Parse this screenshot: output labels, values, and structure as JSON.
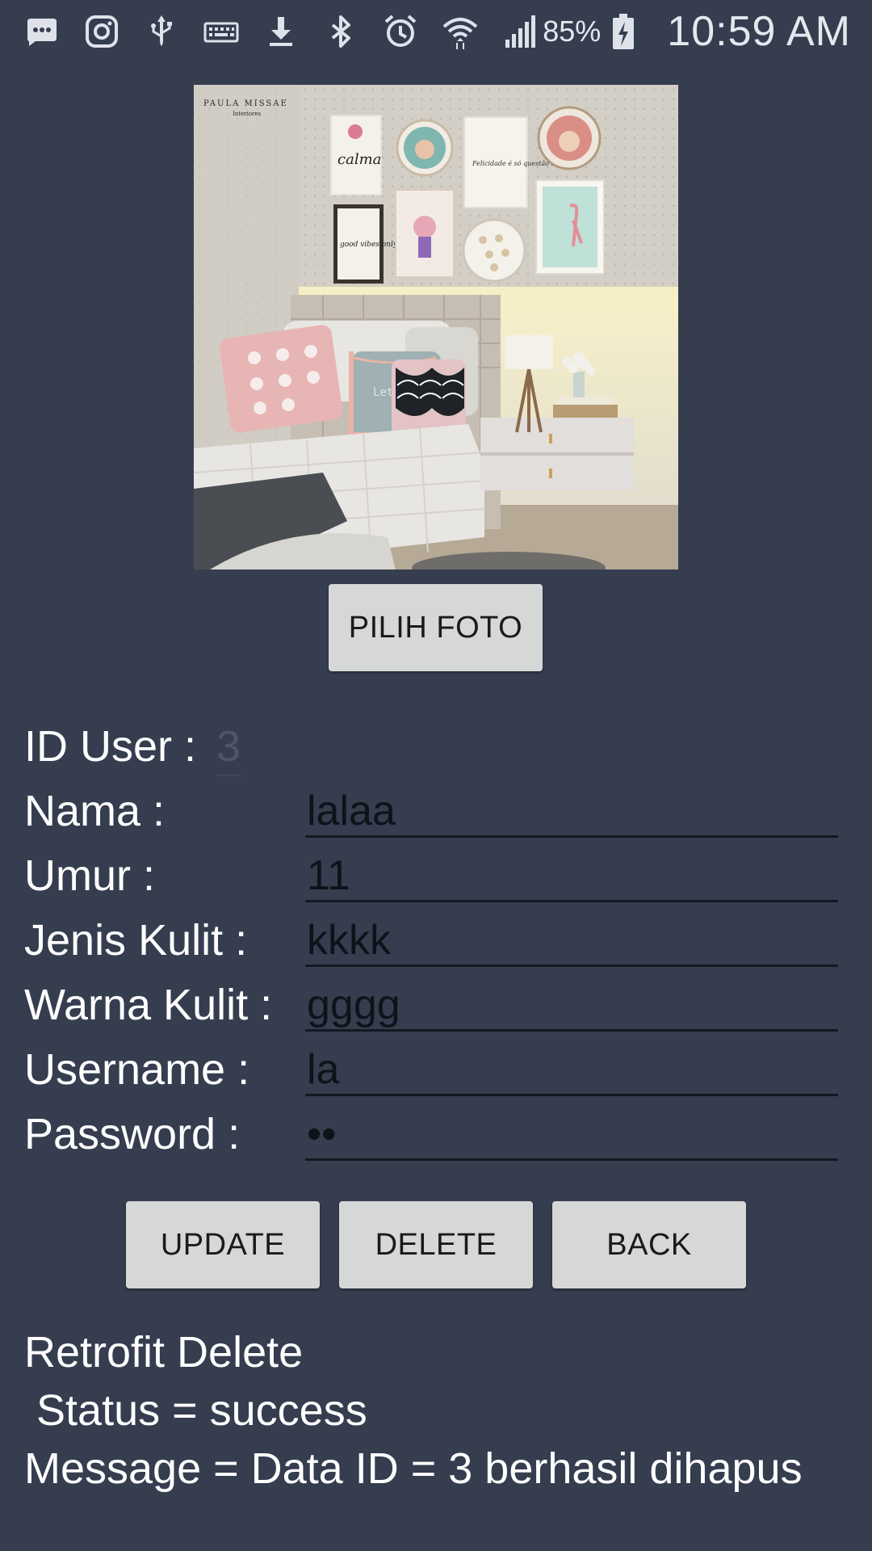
{
  "status_bar": {
    "icons": [
      "messenger-icon",
      "instagram-icon",
      "usb-icon",
      "keyboard-icon",
      "download-icon",
      "bluetooth-icon",
      "alarm-icon",
      "wifi-icon",
      "signal-icon",
      "battery-icon"
    ],
    "battery_percent": "85%",
    "time": "10:59 AM"
  },
  "photo": {
    "watermark_line1": "PAULA MISSAE",
    "watermark_line2": "Interiores",
    "pillow_text": "Let it BE",
    "frame_texts": [
      "calma",
      "good vibes only",
      "Felicidade é só questão de ser"
    ]
  },
  "pick_photo_label": "PILIH FOTO",
  "form": {
    "id_label": "ID User :",
    "id_value": "3",
    "fields": [
      {
        "label": "Nama :",
        "value": "lalaa"
      },
      {
        "label": "Umur :",
        "value": "11"
      },
      {
        "label": "Jenis Kulit :",
        "value": "kkkk"
      },
      {
        "label": "Warna Kulit :",
        "value": "gggg"
      },
      {
        "label": "Username :",
        "value": "la"
      },
      {
        "label": "Password :",
        "value": "••"
      }
    ]
  },
  "buttons": {
    "update": "UPDATE",
    "delete": "DELETE",
    "back": "BACK"
  },
  "result": "Retrofit Delete\n Status = success\nMessage = Data ID = 3 berhasil dihapus",
  "colors": {
    "background": "#353d4f",
    "button": "#d6d7d7",
    "input_underline": "#141821"
  }
}
